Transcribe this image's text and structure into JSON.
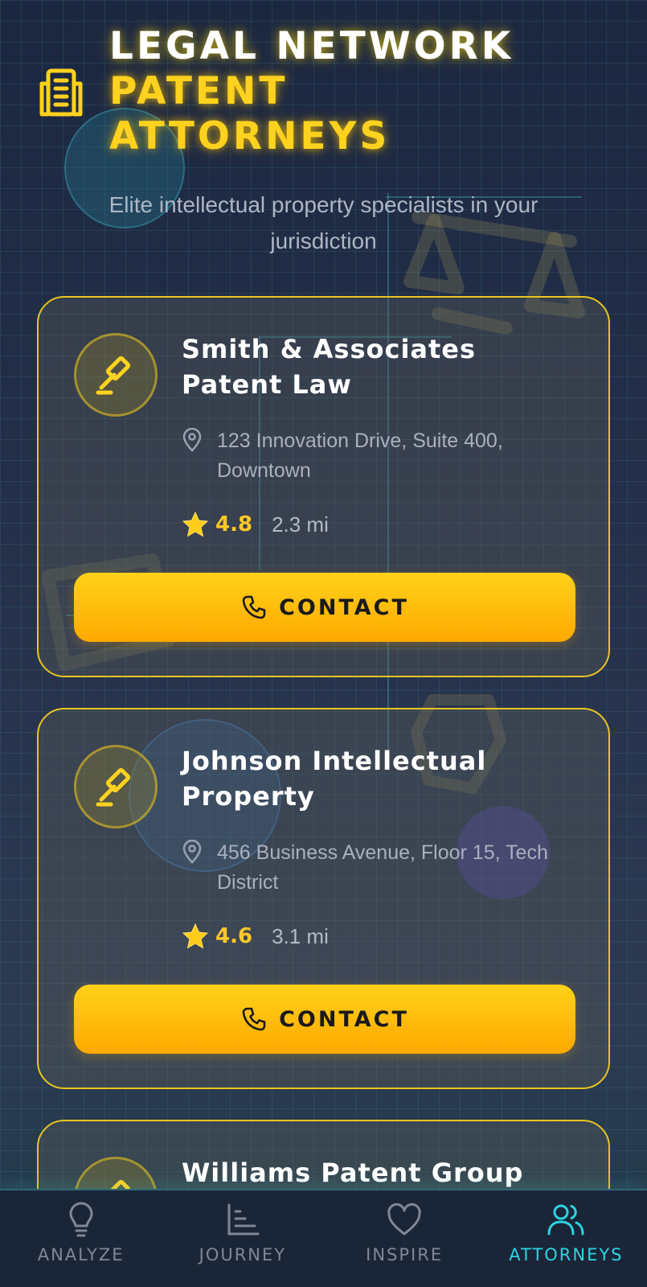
{
  "header": {
    "icon": "building-icon",
    "title_line1": "LEGAL NETWORK",
    "title_line2": "PATENT",
    "title_line3": "ATTORNEYS",
    "subtitle": "Elite intellectual property specialists in your jurisdiction"
  },
  "attorneys": [
    {
      "name": "Smith & Associates Patent Law",
      "address": "123 Innovation Drive, Suite 400, Downtown",
      "rating": "4.8",
      "distance": "2.3 mi",
      "contact_label": "CONTACT",
      "icon": "gavel-icon"
    },
    {
      "name": "Johnson Intellectual Property",
      "address": "456 Business Avenue, Floor 15, Tech District",
      "rating": "4.6",
      "distance": "3.1 mi",
      "contact_label": "CONTACT",
      "icon": "gavel-icon"
    },
    {
      "name": "Williams Patent Group",
      "icon": "gavel-icon"
    }
  ],
  "nav": {
    "items": [
      {
        "label": "ANALYZE",
        "icon": "lightbulb-icon",
        "active": false
      },
      {
        "label": "JOURNEY",
        "icon": "chart-icon",
        "active": false
      },
      {
        "label": "INSPIRE",
        "icon": "heart-icon",
        "active": false
      },
      {
        "label": "ATTORNEYS",
        "icon": "users-icon",
        "active": true
      }
    ]
  },
  "colors": {
    "accent_yellow": "#ffd21f",
    "active_cyan": "#2ad4e2",
    "background": "#1b2740"
  }
}
